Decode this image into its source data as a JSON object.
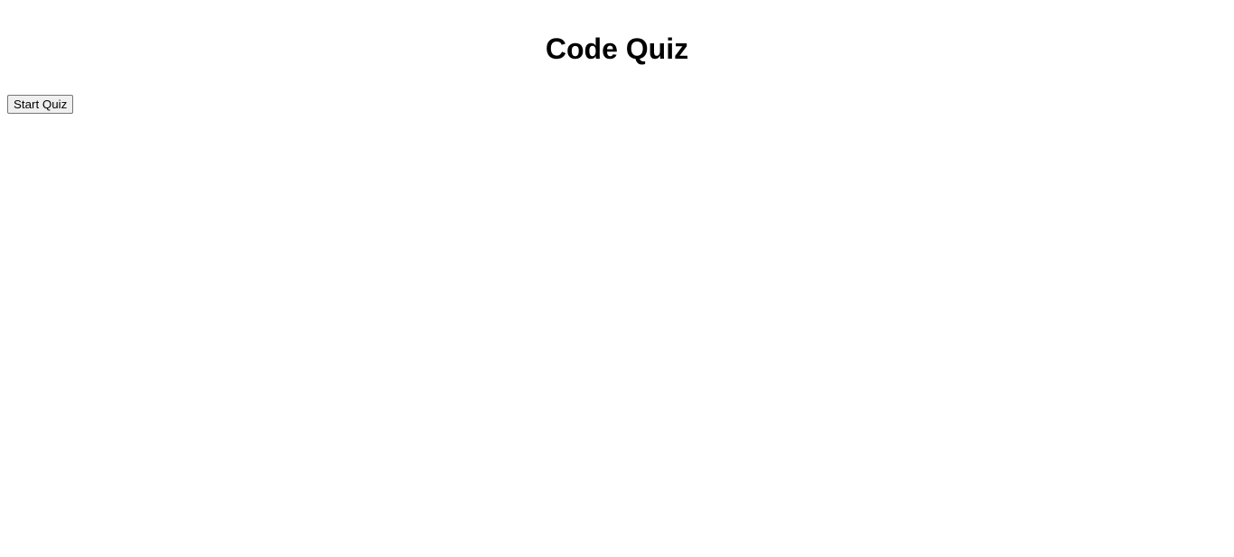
{
  "page": {
    "title": "Code Quiz"
  },
  "controls": {
    "start_label": "Start Quiz"
  }
}
